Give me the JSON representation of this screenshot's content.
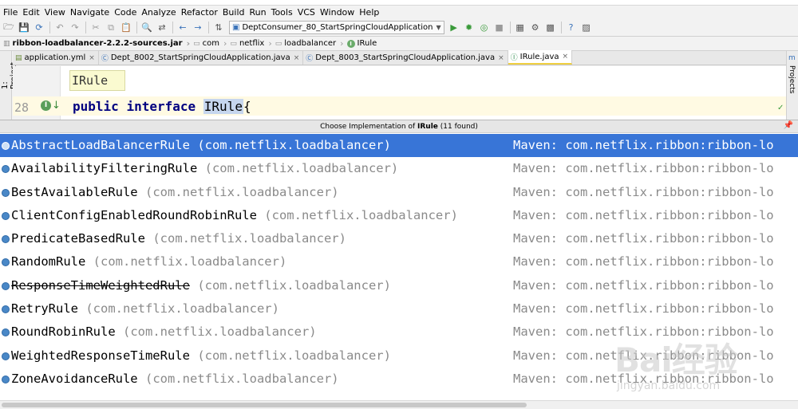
{
  "menubar": [
    "File",
    "Edit",
    "View",
    "Navigate",
    "Code",
    "Analyze",
    "Refactor",
    "Build",
    "Run",
    "Tools",
    "VCS",
    "Window",
    "Help"
  ],
  "toolbar": {
    "run_config": "DeptConsumer_80_StartSpringCloudApplication"
  },
  "breadcrumbs": [
    "ribbon-loadbalancer-2.2.2-sources.jar",
    "com",
    "netflix",
    "loadbalancer",
    "IRule"
  ],
  "tool_windows": {
    "left": "1: Project",
    "right": "Maven Projects"
  },
  "tabs": [
    {
      "label": "application.yml",
      "kind": "yml"
    },
    {
      "label": "Dept_8002_StartSpringCloudApplication.java",
      "kind": "class"
    },
    {
      "label": "Dept_8003_StartSpringCloudApplication.java",
      "kind": "class"
    },
    {
      "label": "IRule.java",
      "kind": "interface",
      "active": true
    }
  ],
  "editor": {
    "hint": "IRule",
    "line_number": "28",
    "keyword_public": "public",
    "keyword_interface": "interface",
    "identifier": "IRule",
    "brace": "{"
  },
  "popup": {
    "title_prefix": "Choose Implementation of ",
    "title_subject": "IRule",
    "title_suffix": " (11 found)",
    "items": [
      {
        "name": "AbstractLoadBalancerRule",
        "package": "(com.netflix.loadbalancer)",
        "library": "Maven: com.netflix.ribbon:ribbon-lo",
        "selected": true,
        "deprecated": false
      },
      {
        "name": "AvailabilityFilteringRule",
        "package": "(com.netflix.loadbalancer)",
        "library": "Maven: com.netflix.ribbon:ribbon-lo",
        "selected": false,
        "deprecated": false
      },
      {
        "name": "BestAvailableRule",
        "package": "(com.netflix.loadbalancer)",
        "library": "Maven: com.netflix.ribbon:ribbon-lo",
        "selected": false,
        "deprecated": false
      },
      {
        "name": "ClientConfigEnabledRoundRobinRule",
        "package": "(com.netflix.loadbalancer)",
        "library": "Maven: com.netflix.ribbon:ribbon-lo",
        "selected": false,
        "deprecated": false
      },
      {
        "name": "PredicateBasedRule",
        "package": "(com.netflix.loadbalancer)",
        "library": "Maven: com.netflix.ribbon:ribbon-lo",
        "selected": false,
        "deprecated": false
      },
      {
        "name": "RandomRule",
        "package": "(com.netflix.loadbalancer)",
        "library": "Maven: com.netflix.ribbon:ribbon-lo",
        "selected": false,
        "deprecated": false
      },
      {
        "name": "ResponseTimeWeightedRule",
        "package": "(com.netflix.loadbalancer)",
        "library": "Maven: com.netflix.ribbon:ribbon-lo",
        "selected": false,
        "deprecated": true
      },
      {
        "name": "RetryRule",
        "package": "(com.netflix.loadbalancer)",
        "library": "Maven: com.netflix.ribbon:ribbon-lo",
        "selected": false,
        "deprecated": false
      },
      {
        "name": "RoundRobinRule",
        "package": "(com.netflix.loadbalancer)",
        "library": "Maven: com.netflix.ribbon:ribbon-lo",
        "selected": false,
        "deprecated": false
      },
      {
        "name": "WeightedResponseTimeRule",
        "package": "(com.netflix.loadbalancer)",
        "library": "Maven: com.netflix.ribbon:ribbon-lo",
        "selected": false,
        "deprecated": false
      },
      {
        "name": "ZoneAvoidanceRule",
        "package": "(com.netflix.loadbalancer)",
        "library": "Maven: com.netflix.ribbon:ribbon-lo",
        "selected": false,
        "deprecated": false
      }
    ]
  },
  "watermark": {
    "logo": "Bai经验",
    "url": "jingyan.baidu.com"
  },
  "colors": {
    "selection": "#3875d7",
    "keyword": "#000080",
    "hint_background": "#fafad0",
    "current_line": "#fffae3"
  }
}
